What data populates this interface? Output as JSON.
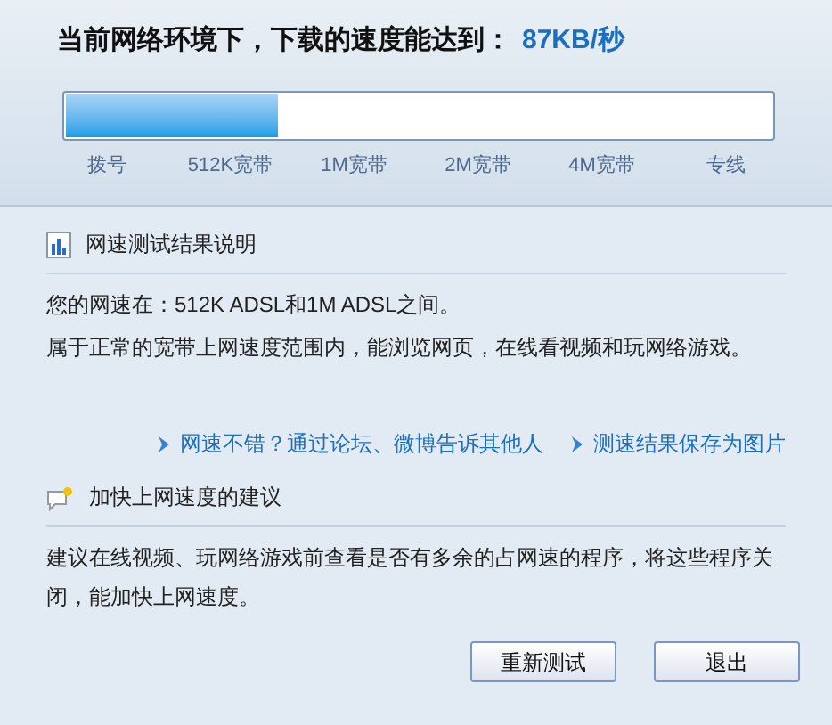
{
  "header": {
    "title": "当前网络环境下，下载的速度能达到：",
    "speed": "87KB/秒"
  },
  "meter": {
    "level": 0.3,
    "ticks": [
      "拨号",
      "512K宽带",
      "1M宽带",
      "2M宽带",
      "4M宽带",
      "专线"
    ]
  },
  "result": {
    "heading": "网速测试结果说明",
    "lines": [
      "您的网速在：512K ADSL和1M ADSL之间。",
      "属于正常的宽带上网速度范围内，能浏览网页，在线看视频和玩网络游戏。"
    ],
    "links": [
      "网速不错？通过论坛、微博告诉其他人",
      "测速结果保存为图片"
    ]
  },
  "advice": {
    "heading": "加快上网速度的建议",
    "text": "建议在线视频、玩网络游戏前查看是否有多余的占网速的程序，将这些程序关闭，能加快上网速度。"
  },
  "buttons": [
    "重新测试",
    "退出"
  ]
}
